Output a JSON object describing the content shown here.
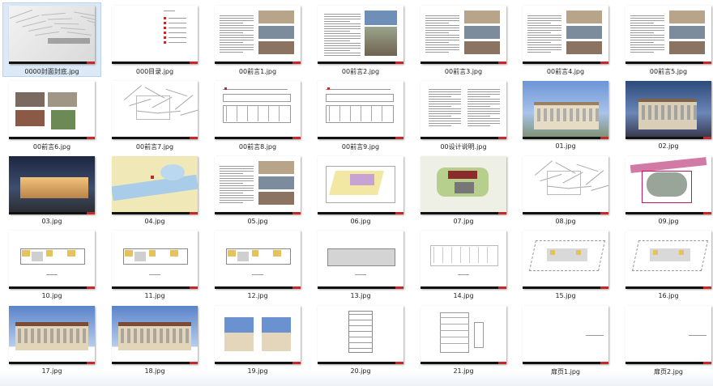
{
  "files": [
    {
      "name": "0000封面封底.jpg",
      "kind": "cover",
      "selected": true
    },
    {
      "name": "000目录.jpg",
      "kind": "toc"
    },
    {
      "name": "00前言1.jpg",
      "kind": "text-photos"
    },
    {
      "name": "00前言2.jpg",
      "kind": "text-photo"
    },
    {
      "name": "00前言3.jpg",
      "kind": "text-photos"
    },
    {
      "name": "00前言4.jpg",
      "kind": "text-photos"
    },
    {
      "name": "00前言5.jpg",
      "kind": "text-photos"
    },
    {
      "name": "00前言6.jpg",
      "kind": "photos"
    },
    {
      "name": "00前言7.jpg",
      "kind": "lines"
    },
    {
      "name": "00前言8.jpg",
      "kind": "drawing"
    },
    {
      "name": "00前言9.jpg",
      "kind": "drawing"
    },
    {
      "name": "00设计说明.jpg",
      "kind": "text"
    },
    {
      "name": "01.jpg",
      "kind": "building-day"
    },
    {
      "name": "02.jpg",
      "kind": "building-dusk"
    },
    {
      "name": "03.jpg",
      "kind": "building-night"
    },
    {
      "name": "04.jpg",
      "kind": "map"
    },
    {
      "name": "05.jpg",
      "kind": "text-photos"
    },
    {
      "name": "06.jpg",
      "kind": "siteplan"
    },
    {
      "name": "07.jpg",
      "kind": "siteplan-color"
    },
    {
      "name": "08.jpg",
      "kind": "lines"
    },
    {
      "name": "09.jpg",
      "kind": "siteplan-pink"
    },
    {
      "name": "10.jpg",
      "kind": "plan"
    },
    {
      "name": "11.jpg",
      "kind": "plan"
    },
    {
      "name": "12.jpg",
      "kind": "plan"
    },
    {
      "name": "13.jpg",
      "kind": "plan-gray"
    },
    {
      "name": "14.jpg",
      "kind": "plan-light"
    },
    {
      "name": "15.jpg",
      "kind": "plan-tri"
    },
    {
      "name": "16.jpg",
      "kind": "plan-tri"
    },
    {
      "name": "17.jpg",
      "kind": "elevation"
    },
    {
      "name": "18.jpg",
      "kind": "elevation"
    },
    {
      "name": "19.jpg",
      "kind": "elevation-two"
    },
    {
      "name": "20.jpg",
      "kind": "section"
    },
    {
      "name": "21.jpg",
      "kind": "section2"
    },
    {
      "name": "扉页1.jpg",
      "kind": "blank"
    },
    {
      "name": "扉页2.jpg",
      "kind": "blank"
    }
  ]
}
